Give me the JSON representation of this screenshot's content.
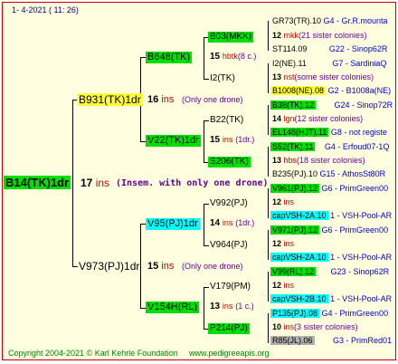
{
  "header": {
    "date": "1-  4-2021 ( 11: 26)"
  },
  "root": {
    "name": "B14(TK)1dr",
    "num": "17",
    "ins": "ins",
    "note": "(Insem. with only one drone)"
  },
  "p1": {
    "name": "B931(TK)1dr",
    "num": "16",
    "ins": "ins",
    "note": "(Only one drone)"
  },
  "p2": {
    "name": "V973(PJ)1dr",
    "num": "15",
    "ins": "ins",
    "note": "(Only one drone)"
  },
  "g1": {
    "name": "B648(TK)",
    "num": "15",
    "hb": "hbtk",
    "note": "(8 c.)"
  },
  "g2": {
    "name": "V22(TK)1dr",
    "num": "15",
    "ins": "ins",
    "note": "(1dr.)"
  },
  "g3": {
    "name": "V95(PJ)1dr",
    "num": "14",
    "ins": "ins",
    "note": "(1dr.)"
  },
  "g4": {
    "name": "V154H(RL)",
    "num": "13",
    "ins": "ins",
    "note": "(1 c.)"
  },
  "gg": [
    {
      "name": "B03(MKK)"
    },
    {
      "name": "I2(TK)"
    },
    {
      "name": "B22(TK)"
    },
    {
      "name": "S206(TK)"
    },
    {
      "name": "V992(PJ)"
    },
    {
      "name": "V964(PJ)"
    },
    {
      "name": "V179(PM)"
    },
    {
      "name": "P214(PJ)"
    }
  ],
  "right": [
    {
      "a": "GR73(TR).10",
      "b": "G4 - Gr.R.mounta"
    },
    {
      "n": "12",
      "m": "mkk",
      "c": "(21 sister colonies)"
    },
    {
      "a": "ST114.09",
      "b": "G22 - Sinop62R"
    },
    {
      "a": "I2(NE).11",
      "b": "G7 - SardiniaQ"
    },
    {
      "n": "13",
      "m": "nst",
      "c": "(some sister colonies)"
    },
    {
      "a": "B1008(NE).08",
      "b": "G2 - B1008a(NE)"
    },
    {
      "a": "B38(TK).12",
      "b": "G24 - Sinop72R"
    },
    {
      "n": "14",
      "m": "lgn",
      "c": "(12 sister colonies)"
    },
    {
      "a": "EL148(HJT).11",
      "b": "G8 - not registe"
    },
    {
      "a": "S52(TK).11",
      "b": "G4 - Erfoud07-1Q"
    },
    {
      "n": "13",
      "m": "hbs",
      "c": "(18 sister colonies)"
    },
    {
      "a": "B235(PJ).10",
      "b": "G15 - AthosSt80R"
    },
    {
      "a": "V961(PJ).12",
      "b": "G6 - PrimGreen00"
    },
    {
      "n": "12",
      "m": "ins",
      "c": ""
    },
    {
      "a": "capVSH-2A.10",
      "b": "1 - VSH-Pool-AR"
    },
    {
      "a": "V971(PJ).12",
      "b": "G6 - PrimGreen00"
    },
    {
      "n": "12",
      "m": "ins",
      "c": ""
    },
    {
      "a": "capVSH-2A.10",
      "b": "1 - VSH-Pool-AR"
    },
    {
      "a": "V99(RL).12",
      "b": "G23 - Sinop62R"
    },
    {
      "n": "12",
      "m": "ins",
      "c": ""
    },
    {
      "a": "capVSH-2B.10",
      "b": "1 - VSH-Pool-AR"
    },
    {
      "a": "P135(PJ).08",
      "b": "G4 - PrimGreen00"
    },
    {
      "n": "10",
      "m": "ins",
      "c": "(3 sister colonies)"
    },
    {
      "a": "R85(JL).06",
      "b": "G3 - PrimRed01"
    }
  ],
  "footer": {
    "copyright": "Copyright 2004-2021 © Karl Kehrle Foundation",
    "site": "www.pedigreeapis.org"
  }
}
